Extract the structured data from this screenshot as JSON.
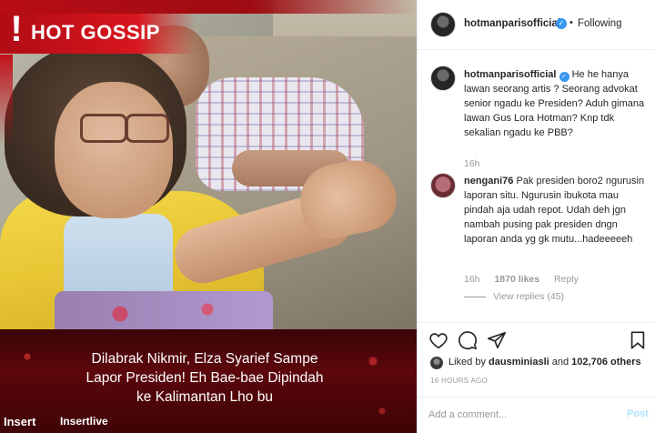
{
  "post_image": {
    "banner_mark": "!",
    "banner_title": "HOT GOSSIP",
    "caption": "Dilabrak Nikmir,  Elza Syarief Sampe\nLapor Presiden!  Eh Bae-bae Dipindah\nke Kalimantan Lho bu",
    "logo_left": "Insert",
    "logo_right": "Insertlive"
  },
  "header": {
    "username": "hotmanparisofficial",
    "verified_mark": "✓",
    "separator": "•",
    "follow_status": "Following"
  },
  "comments": [
    {
      "username": "hotmanparisofficial",
      "text": "He he hanya lawan seorang artis ? Seorang advokat senior ngadu ke Presiden? Aduh gimana lawan Gus Lora Hotman? Knp tdk sekalian ngadu ke PBB?",
      "time": "16h"
    },
    {
      "username": "nengani76",
      "text": "Pak presiden boro2 ngurusin laporan situ. Ngurusin ibukota mau pindah aja udah repot. Udah deh jgn nambah pusing pak presiden dngn laporan anda yg gk mutu...hadeeeeeh",
      "time": "16h",
      "likes": "1870 likes",
      "reply_label": "Reply",
      "view_replies": "View replies (45)"
    }
  ],
  "likes": {
    "prefix": "Liked by",
    "user": "dausminiasli",
    "middle": "and",
    "count": "102,706 others"
  },
  "timestamp": "16 HOURS AGO",
  "add_comment": {
    "placeholder": "Add a comment...",
    "post_label": "Post"
  },
  "icons": [
    "heart-icon",
    "comment-icon",
    "share-icon",
    "bookmark-icon"
  ],
  "colors": {
    "verified": "#3897f0",
    "banner_red": "#d9161f",
    "post_button": "#b2dffc"
  }
}
